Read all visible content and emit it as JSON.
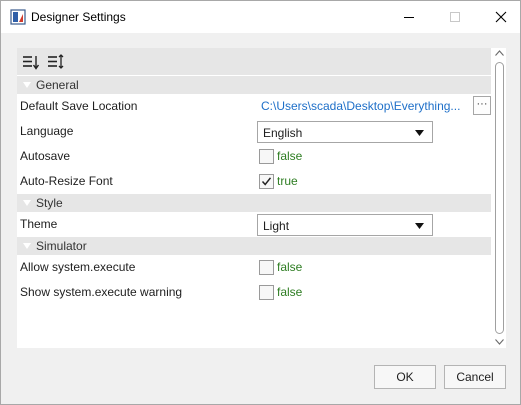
{
  "window": {
    "title": "Designer Settings",
    "icons": {
      "app": "designer-app-icon",
      "minimize": "minimize-icon",
      "maximize": "maximize-icon",
      "close": "close-icon"
    }
  },
  "toolbar": {
    "icons": {
      "sort": "sort-alphabetical-icon",
      "categorize": "categorized-list-icon"
    }
  },
  "categories": {
    "general": "General",
    "style": "Style",
    "simulator": "Simulator"
  },
  "properties": {
    "default_save_location": {
      "label": "Default Save Location",
      "value": "C:\\Users\\scada\\Desktop\\Everything...",
      "button": "···"
    },
    "language": {
      "label": "Language",
      "value": "English"
    },
    "autosave": {
      "label": "Autosave",
      "checked": false,
      "value": "false"
    },
    "auto_resize_font": {
      "label": "Auto-Resize Font",
      "checked": true,
      "value": "true"
    },
    "theme": {
      "label": "Theme",
      "value": "Light"
    },
    "allow_system_execute": {
      "label": "Allow system.execute",
      "checked": false,
      "value": "false"
    },
    "show_system_execute_warning": {
      "label": "Show system.execute warning",
      "checked": false,
      "value": "false"
    }
  },
  "buttons": {
    "ok": "OK",
    "cancel": "Cancel"
  },
  "colors": {
    "link_blue": "#1e6fc8",
    "bool_green": "#2e7d22",
    "category_bg": "#e6e6e6"
  }
}
